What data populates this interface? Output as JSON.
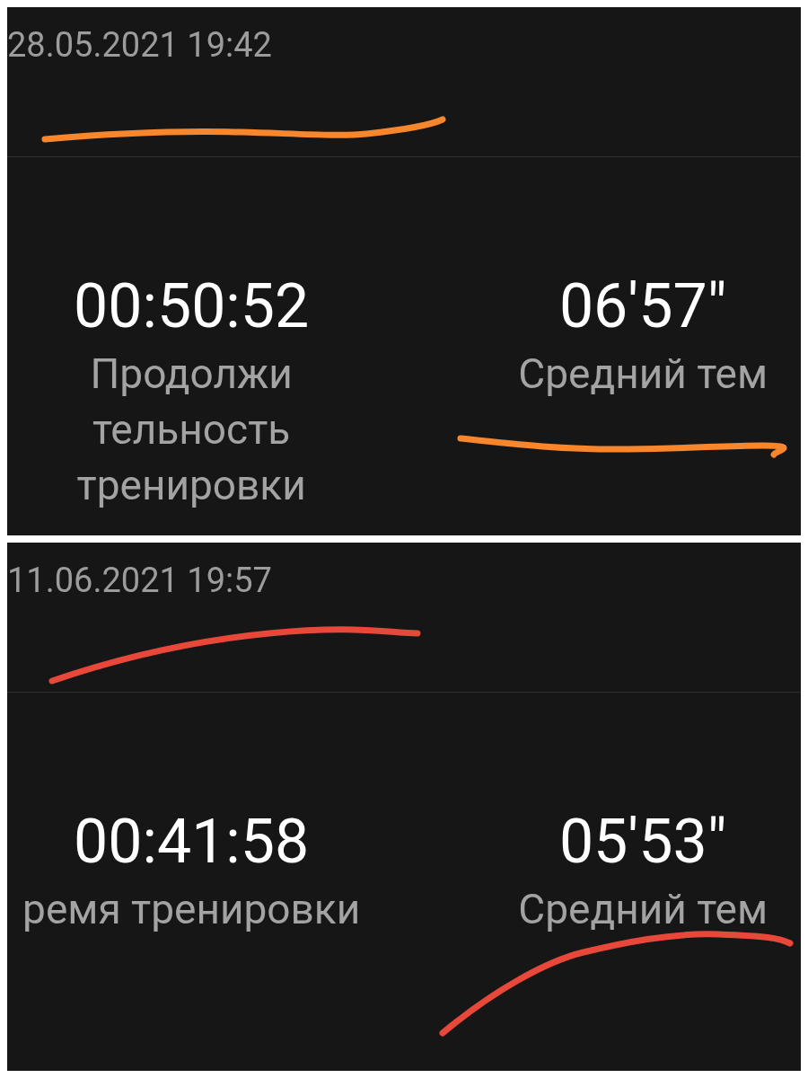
{
  "panels": [
    {
      "date": "28.05.2021 19:42",
      "color": "#f7862c",
      "stats": [
        {
          "value": "00:50:52",
          "label_lines": [
            "Продолжи",
            "тельность",
            "тренировки"
          ]
        },
        {
          "value": "06'57\"",
          "label_lines": [
            "Средний тем"
          ]
        }
      ]
    },
    {
      "date": "11.06.2021 19:57",
      "color": "#e8483a",
      "stats": [
        {
          "value": "00:41:58",
          "label_lines": [
            "ремя тренировки"
          ]
        },
        {
          "value": "05'53\"",
          "label_lines": [
            "Средний тем"
          ]
        }
      ]
    }
  ]
}
